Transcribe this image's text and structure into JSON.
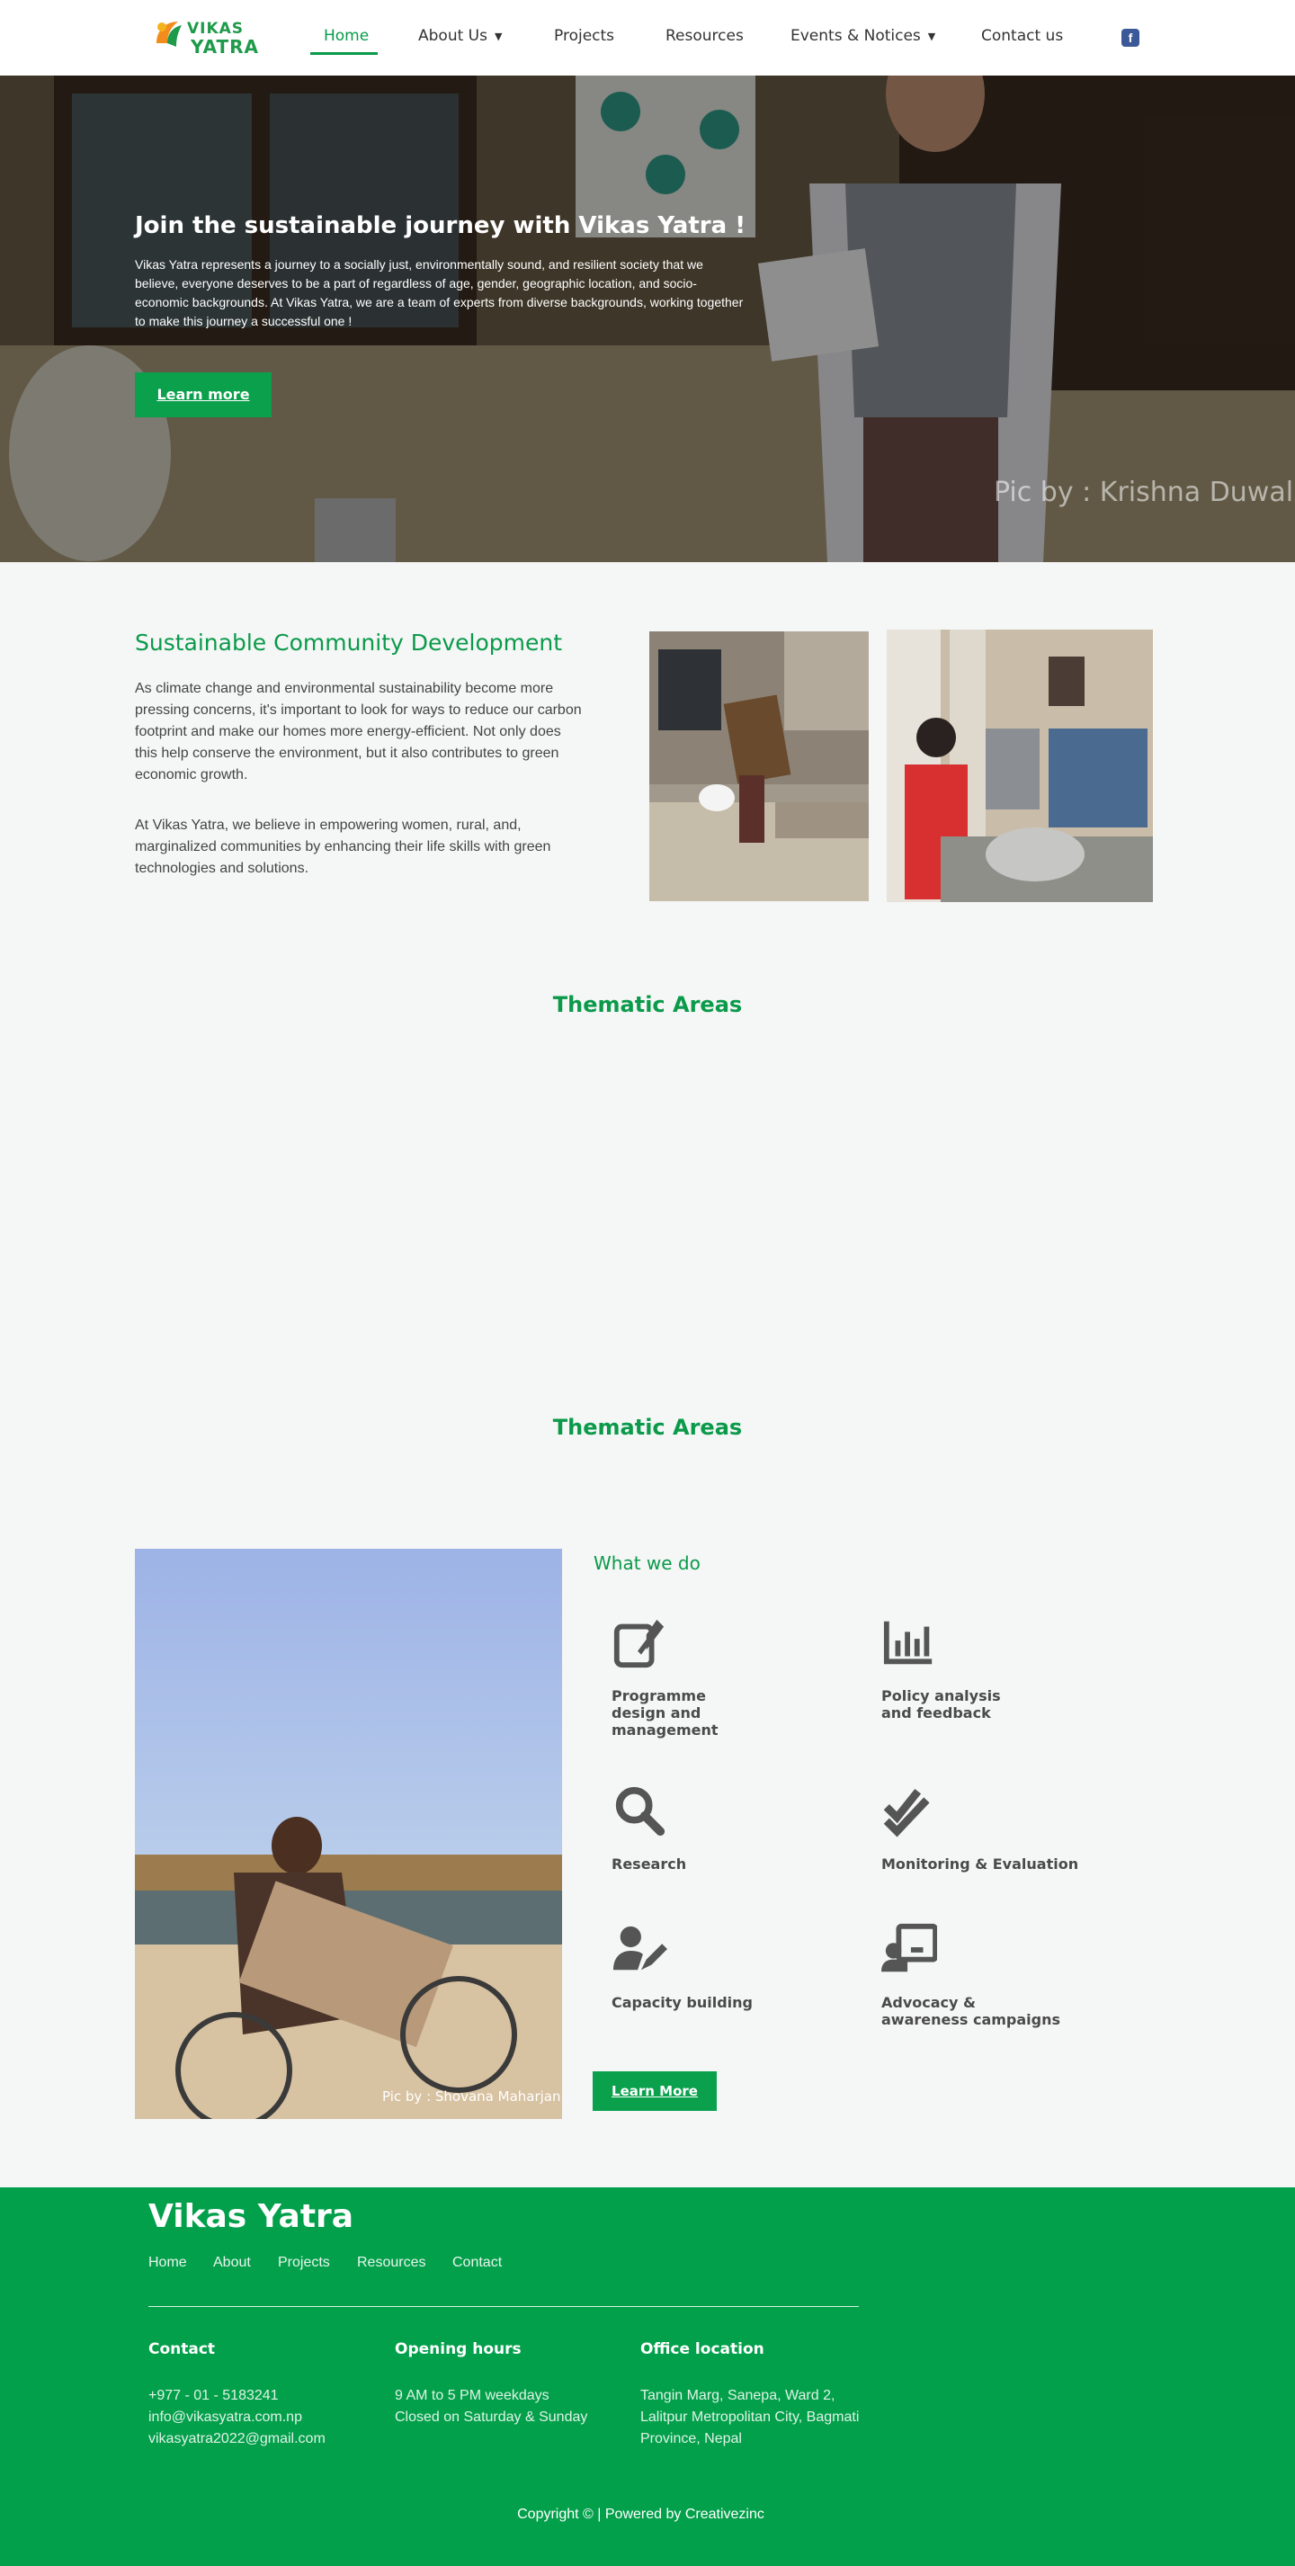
{
  "header": {
    "logo": {
      "line1": "VIKAS",
      "line2": "YATRA"
    },
    "nav": [
      {
        "label": "Home",
        "active": true,
        "dropdown": false
      },
      {
        "label": "About Us",
        "active": false,
        "dropdown": true
      },
      {
        "label": "Projects",
        "active": false,
        "dropdown": false
      },
      {
        "label": "Resources",
        "active": false,
        "dropdown": false
      },
      {
        "label": "Events & Notices",
        "active": false,
        "dropdown": true
      },
      {
        "label": "Contact us",
        "active": false,
        "dropdown": false
      }
    ],
    "facebook_icon": "facebook-icon"
  },
  "hero": {
    "title": "Join the sustainable journey with Vikas Yatra !",
    "text": "Vikas Yatra represents a journey to a socially just, environmentally sound, and resilient society that we believe, everyone deserves to be a part of regardless of age, gender, geographic location, and socio-economic backgrounds. At Vikas Yatra, we are a team of experts from diverse backgrounds, working together to make this journey a successful one !",
    "button": "Learn more",
    "credit": "Pic by : Krishna Duwal"
  },
  "sustainable": {
    "title": "Sustainable Community Development",
    "paragraph1": "As climate change and environmental sustainability become more pressing concerns, it's important to look for ways to reduce our carbon footprint and make our homes more energy-efficient. Not only does this help conserve the environment, but it also contributes to green economic growth.",
    "paragraph2": "At Vikas Yatra, we believe in empowering women, rural, and, marginalized communities by enhancing their life skills with green technologies and solutions."
  },
  "thematic": {
    "heading1": "Thematic Areas",
    "heading2": "Thematic Areas"
  },
  "what_we_do": {
    "title": "What we do",
    "photo_credit": "Pic by : Shovana Maharjan",
    "services": [
      {
        "label": "Programme design and management",
        "icon": "edit-icon"
      },
      {
        "label": "Policy analysis and feedback",
        "icon": "chart-bar-icon"
      },
      {
        "label": "Research",
        "icon": "search-icon"
      },
      {
        "label": "Monitoring & Evaluation",
        "icon": "double-check-icon"
      },
      {
        "label": "Capacity building",
        "icon": "user-edit-icon"
      },
      {
        "label": "Advocacy & awareness campaigns",
        "icon": "presentation-icon"
      }
    ],
    "button": "Learn More"
  },
  "footer": {
    "brand": "Vikas Yatra",
    "nav": [
      "Home",
      "About",
      "Projects",
      "Resources",
      "Contact"
    ],
    "contact": {
      "title": "Contact",
      "lines": [
        "+977 - 01 - 5183241",
        "info@vikasyatra.com.np",
        "vikasyatra2022@gmail.com"
      ]
    },
    "hours": {
      "title": "Opening hours",
      "lines": [
        "9 AM to 5 PM weekdays",
        "Closed on Saturday & Sunday"
      ]
    },
    "location": {
      "title": "Office location",
      "lines": [
        "Tangin Marg, Sanepa, Ward 2,",
        "Lalitpur Metropolitan City, Bagmati",
        "Province, Nepal"
      ]
    },
    "copyright": "Copyright © | Powered by Creativezinc"
  },
  "colors": {
    "brand_green": "#0a9a4a",
    "footer_green": "#03a04b",
    "facebook_blue": "#3b5998"
  }
}
